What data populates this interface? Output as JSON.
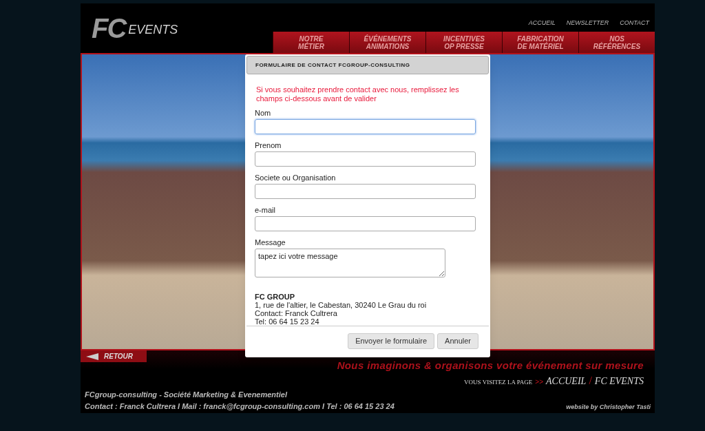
{
  "header": {
    "logo_mark": "FC",
    "logo_text": "EVENTS",
    "top_links": [
      "ACCUEIL",
      "NEWSLETTER",
      "CONTACT"
    ],
    "nav": [
      {
        "lines": [
          "NOTRE",
          "MÉTIER"
        ]
      },
      {
        "lines": [
          "ÉVÉNEMENTS",
          "ANIMATIONS"
        ]
      },
      {
        "lines": [
          "INCENTIVES",
          "OP PRESSE"
        ]
      },
      {
        "lines": [
          "FABRICATION",
          "DE MATÉRIEL"
        ]
      },
      {
        "lines": [
          "NOS",
          "RÉFÉRENCES"
        ]
      }
    ]
  },
  "dialog": {
    "title": "FORMULAIRE DE CONTACT FCGROUP-CONSULTING",
    "intro": "Si vous souhaitez prendre contact avec nous, remplissez les champs ci-dessous avant de valider",
    "fields": [
      {
        "kind": "input",
        "label": "Nom",
        "focused": true
      },
      {
        "kind": "input",
        "label": "Prenom",
        "focused": false
      },
      {
        "kind": "input",
        "label": "Societe ou Organisation",
        "focused": false
      },
      {
        "kind": "input",
        "label": "e-mail",
        "focused": false
      },
      {
        "kind": "textarea",
        "label": "Message",
        "value": "tapez ici votre message",
        "focused": false
      }
    ],
    "company": "FC GROUP",
    "address_lines": [
      "1, rue de l'altier, le Cabestan, 30240 Le Grau du roi",
      "Contact: Franck Cultrera",
      "Tel: 06 64 15 23 24"
    ],
    "buttons": [
      "Envoyer le formulaire",
      "Annuler"
    ]
  },
  "footer": {
    "back": "RETOUR",
    "slogan": "Nous imaginons & organisons votre événement sur mesure",
    "visit_label": "VOUS VISITEZ LA PAGE",
    "visit_arrows": ">>",
    "crumbs": [
      "ACCUEIL",
      "FC EVENTS"
    ],
    "crumb_sep": "/",
    "company_line": "FCgroup-consulting - Société Marketing & Evenementiel",
    "contact_line": "Contact : Franck Cultrera I Mail : franck@fcgroup-consulting.com I Tel : 06 64 15 23 24",
    "credit": "website by Christopher Tasti"
  }
}
